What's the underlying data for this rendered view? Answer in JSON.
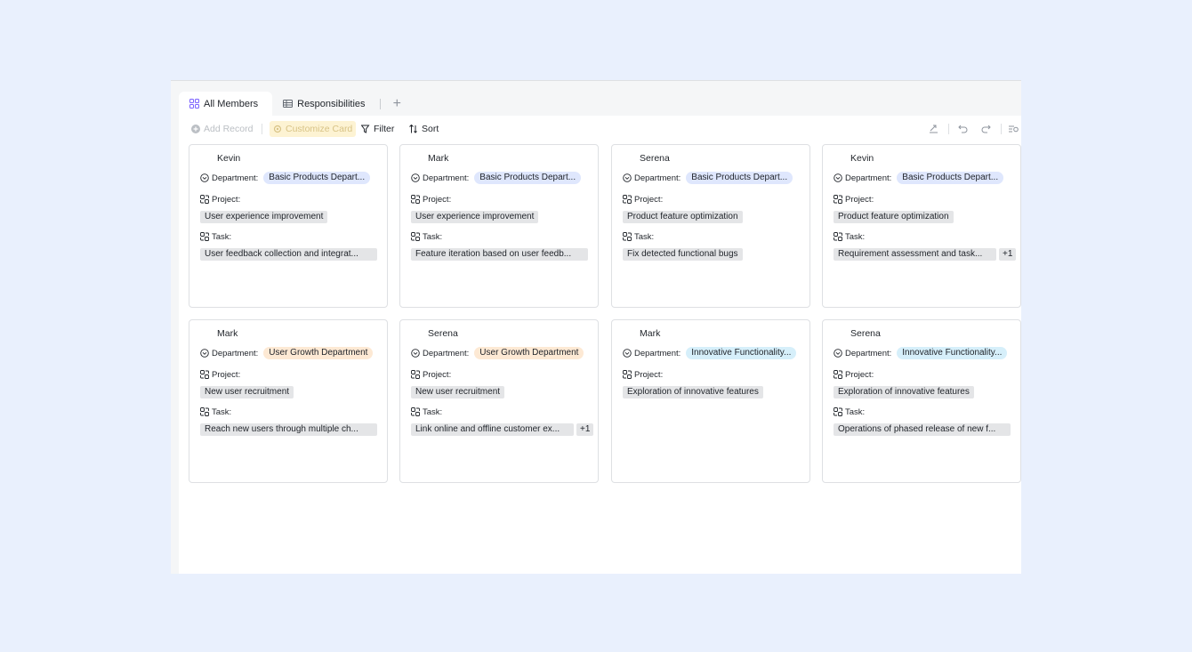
{
  "tabs": [
    {
      "label": "All Members",
      "icon": "grid-icon",
      "active": true
    },
    {
      "label": "Responsibilities",
      "icon": "table-icon",
      "active": false
    }
  ],
  "toolbar": {
    "add_record": "Add Record",
    "customize_card": "Customize Card",
    "filter": "Filter",
    "sort": "Sort"
  },
  "field_labels": {
    "department": "Department:",
    "project": "Project:",
    "task": "Task:"
  },
  "colors": {
    "dept_basic": "#dfe7fd",
    "dept_growth": "#fde9d4",
    "dept_innovative": "#d6effa"
  },
  "cards": [
    {
      "name": "Kevin",
      "department": "Basic Products Depart...",
      "dept_color": "#dfe7fd",
      "project": "User experience improvement",
      "task": "User feedback collection and integrat...",
      "task_more": ""
    },
    {
      "name": "Mark",
      "department": "Basic Products Depart...",
      "dept_color": "#dfe7fd",
      "project": "User experience improvement",
      "task": "Feature iteration based on user feedb...",
      "task_more": ""
    },
    {
      "name": "Serena",
      "department": "Basic Products Depart...",
      "dept_color": "#dfe7fd",
      "project": "Product feature optimization",
      "task": "Fix detected functional bugs",
      "task_more": ""
    },
    {
      "name": "Kevin",
      "department": "Basic Products Depart...",
      "dept_color": "#dfe7fd",
      "project": "Product feature optimization",
      "task": "Requirement assessment and task...",
      "task_more": "+1"
    },
    {
      "name": "Mark",
      "department": "User Growth Department",
      "dept_color": "#fde9d4",
      "project": "New user recruitment",
      "task": "Reach new users through multiple ch...",
      "task_more": ""
    },
    {
      "name": "Serena",
      "department": "User Growth Department",
      "dept_color": "#fde9d4",
      "project": "New user recruitment",
      "task": "Link online and offline customer ex...",
      "task_more": "+1"
    },
    {
      "name": "Mark",
      "department": "Innovative Functionality...",
      "dept_color": "#d6effa",
      "project": "Exploration of innovative features",
      "task": "",
      "task_more": ""
    },
    {
      "name": "Serena",
      "department": "Innovative Functionality...",
      "dept_color": "#d6effa",
      "project": "Exploration of innovative features",
      "task": "Operations of phased release of new f...",
      "task_more": ""
    }
  ]
}
